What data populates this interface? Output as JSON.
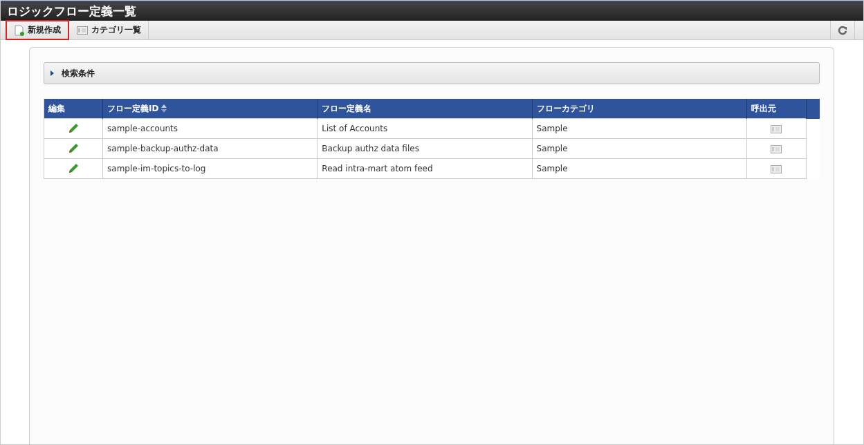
{
  "window": {
    "title": "ロジックフロー定義一覧"
  },
  "toolbar": {
    "buttons": [
      {
        "label": "新規作成",
        "kind": "new-document",
        "highlighted": true
      },
      {
        "label": "カテゴリ一覧",
        "kind": "list",
        "highlighted": false
      }
    ]
  },
  "search_panel": {
    "label": "検索条件",
    "expanded": false
  },
  "table": {
    "columns": [
      {
        "label": "編集",
        "sortable": false
      },
      {
        "label": "フロー定義ID",
        "sortable": true
      },
      {
        "label": "フロー定義名",
        "sortable": false
      },
      {
        "label": "フローカテゴリ",
        "sortable": false
      },
      {
        "label": "呼出元",
        "sortable": false
      }
    ],
    "rows": [
      {
        "id": "sample-accounts",
        "name": "List of Accounts",
        "category": "Sample"
      },
      {
        "id": "sample-backup-authz-data",
        "name": "Backup authz data files",
        "category": "Sample"
      },
      {
        "id": "sample-im-topics-to-log",
        "name": "Read intra-mart atom feed",
        "category": "Sample"
      }
    ]
  }
}
